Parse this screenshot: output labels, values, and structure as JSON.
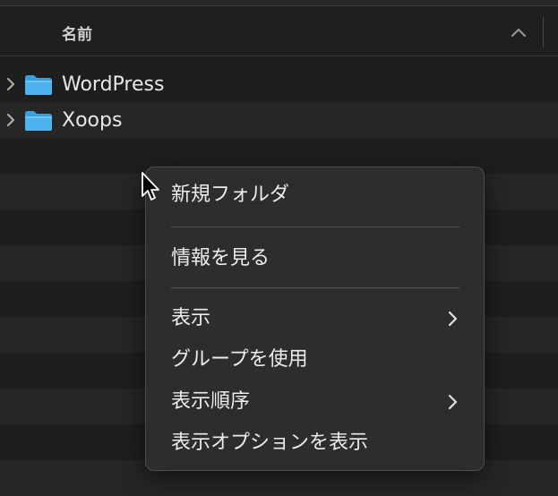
{
  "header": {
    "name_column": "名前"
  },
  "files": [
    {
      "name": "WordPress",
      "kind": "folder",
      "expanded": false
    },
    {
      "name": "Xoops",
      "kind": "folder",
      "expanded": false
    }
  ],
  "context_menu": {
    "items": [
      {
        "label": "新規フォルダ",
        "submenu": false
      },
      {
        "label": "情報を見る",
        "submenu": false
      },
      {
        "label": "表示",
        "submenu": true
      },
      {
        "label": "グループを使用",
        "submenu": false
      },
      {
        "label": "表示順序",
        "submenu": true
      },
      {
        "label": "表示オプションを表示",
        "submenu": false
      }
    ]
  },
  "colors": {
    "background": "#1e1e1e",
    "row_alt": "#262626",
    "folder_blue": "#4fb3f0",
    "menu_bg": "#2d2d2d",
    "text": "#ececec"
  }
}
